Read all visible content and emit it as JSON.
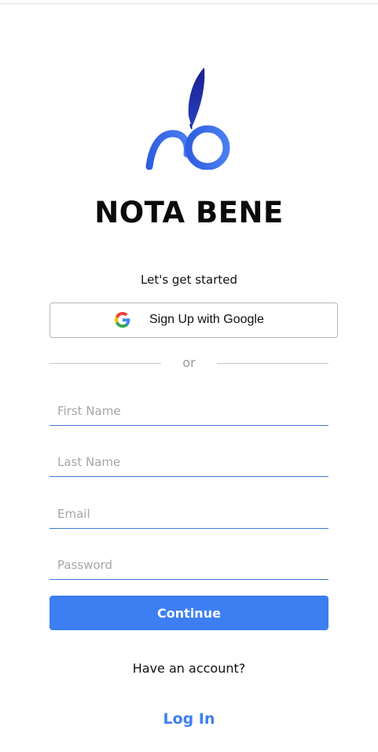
{
  "brand": {
    "logo_icon": "nota-bene-quill-logo-icon",
    "name": "NOTA BENE"
  },
  "signup": {
    "subtitle": "Let's get started",
    "google_button": {
      "icon": "google-g-icon",
      "label": "Sign Up with Google"
    },
    "divider_text": "or",
    "fields": {
      "first_name": {
        "placeholder": "First Name",
        "value": ""
      },
      "last_name": {
        "placeholder": "Last Name",
        "value": ""
      },
      "email": {
        "placeholder": "Email",
        "value": ""
      },
      "password": {
        "placeholder": "Password",
        "value": ""
      }
    },
    "continue_label": "Continue",
    "have_account_text": "Have an account?",
    "login_label": "Log In"
  },
  "colors": {
    "accent": "#3d7ef2",
    "logo_dark": "#1a1f8f",
    "logo_light": "#3b6fe8",
    "field_underline": "#3b78d8",
    "border": "#b8b8b8"
  }
}
